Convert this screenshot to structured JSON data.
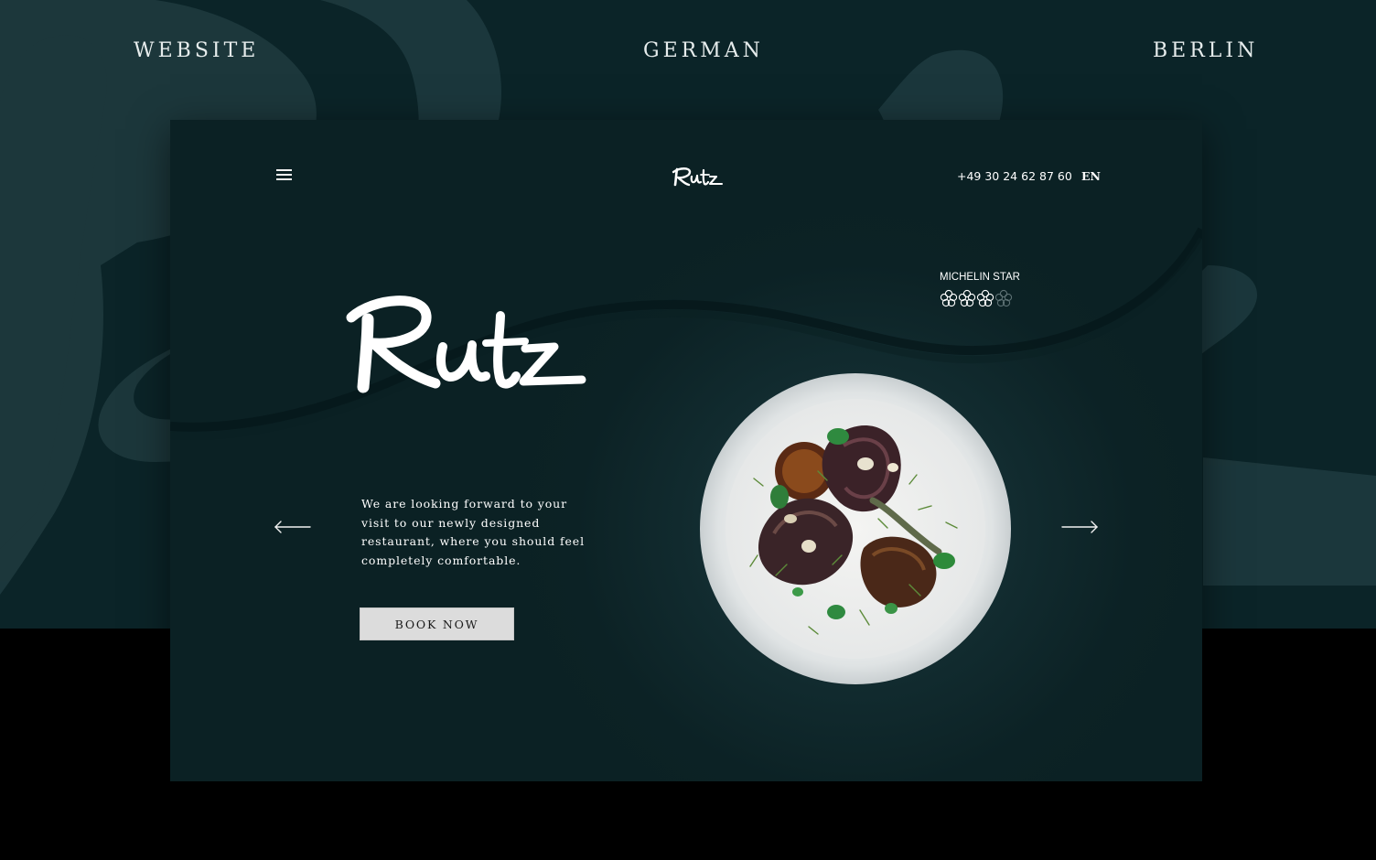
{
  "categories": {
    "left": "WEBSITE",
    "center": "GERMAN",
    "right": "BERLIN"
  },
  "header": {
    "logo_text": "Rutz",
    "phone": "+49 30 24 62 87 60",
    "language": "EN"
  },
  "hero": {
    "logo_text": "Rutz",
    "michelin_label": "MICHELIN STAR",
    "michelin_stars_earned": 3,
    "michelin_stars_total": 4,
    "intro": "We are looking forward to your visit to our newly designed restaurant, where you should feel completely comfortable.",
    "cta": "BOOK NOW"
  },
  "colors": {
    "backdrop": "#0b2428",
    "panel": "#0c2225",
    "text": "#ffffff",
    "button": "#dcdcdc"
  },
  "icons": {
    "menu": "hamburger-icon",
    "prev": "arrow-left-icon",
    "next": "arrow-right-icon",
    "star": "michelin-star-icon"
  }
}
